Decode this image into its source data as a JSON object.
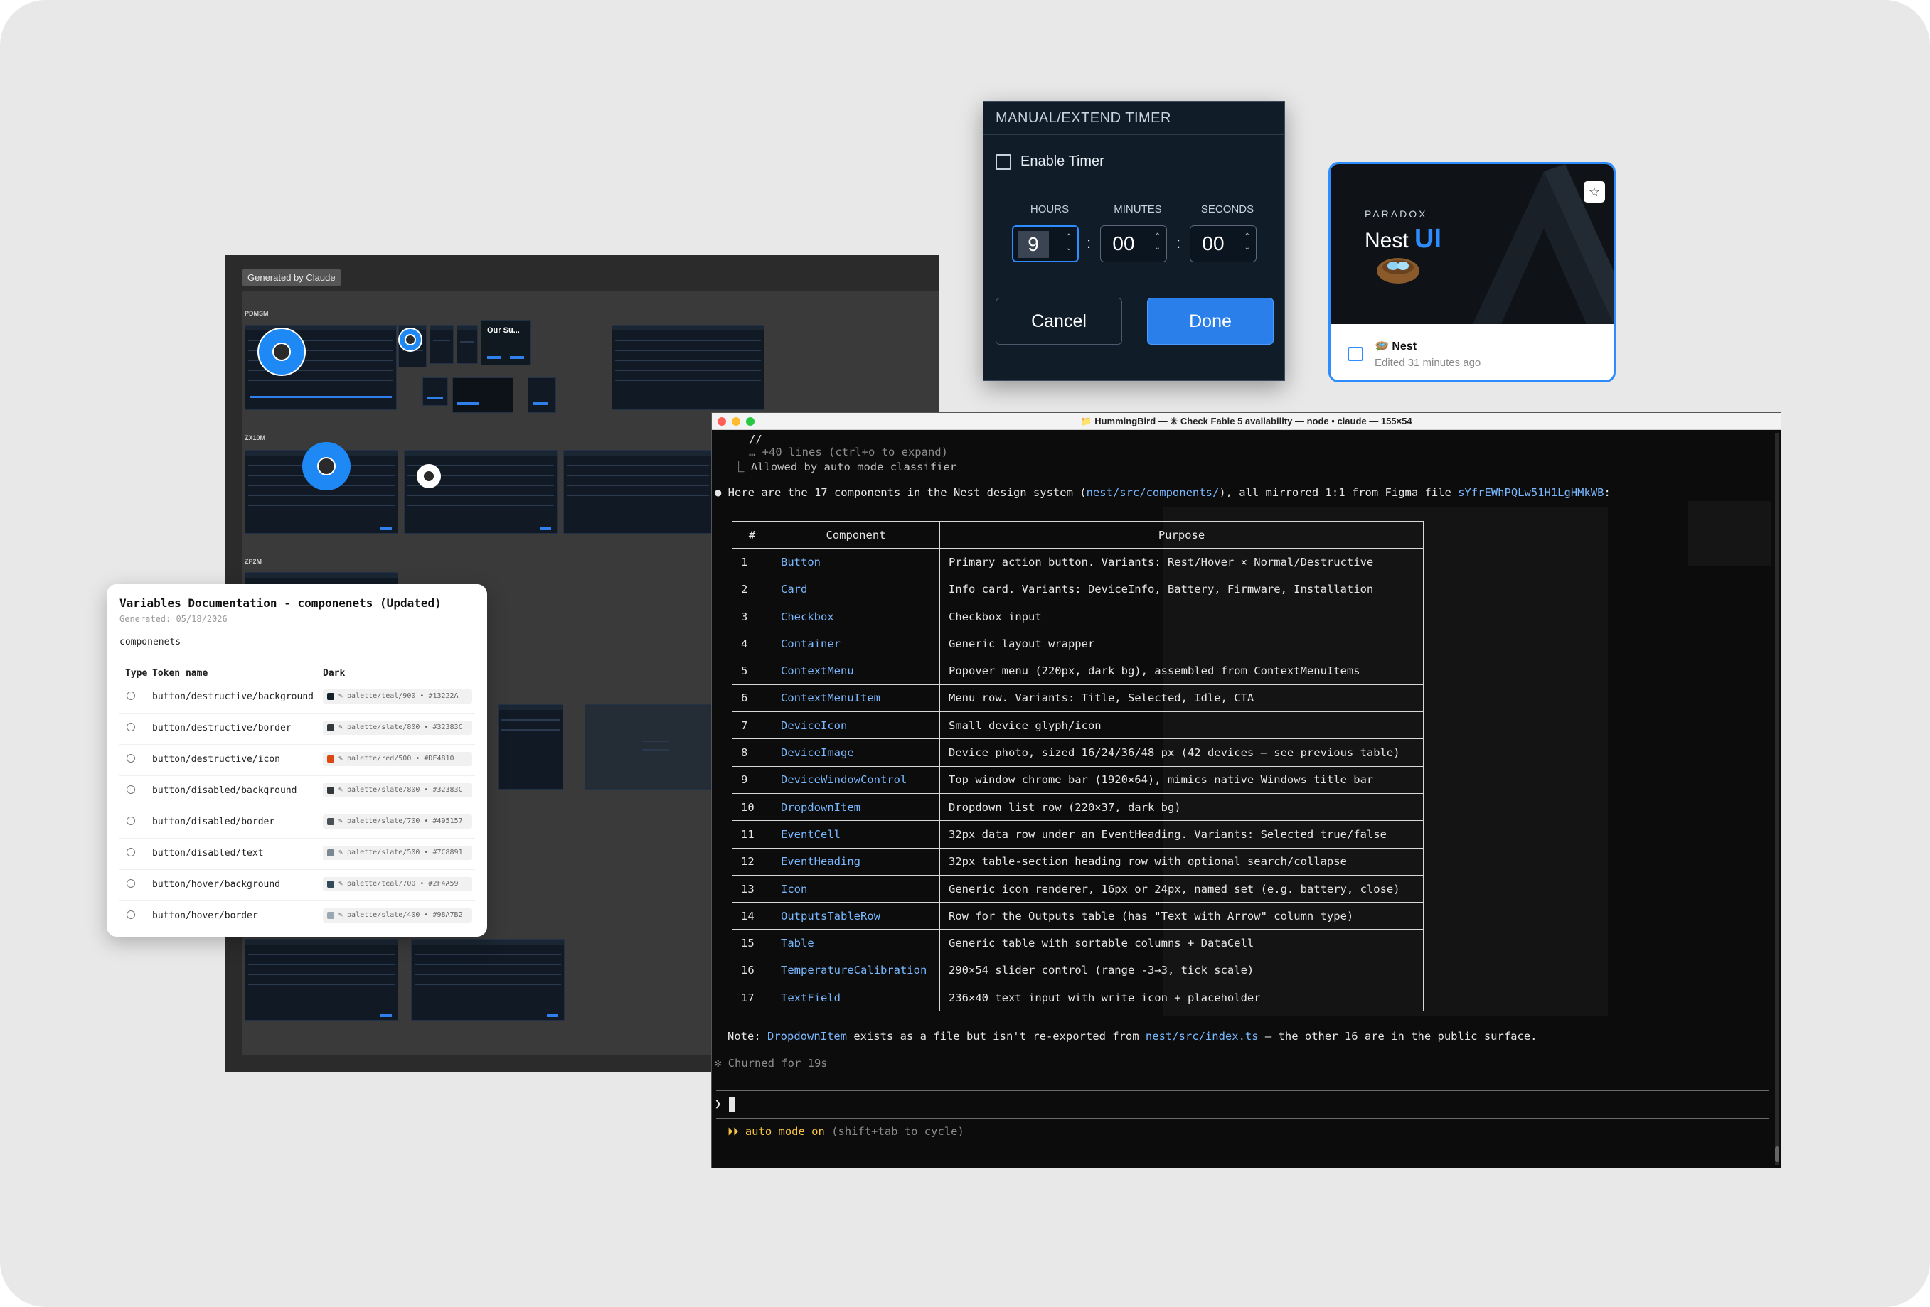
{
  "figma": {
    "badge": "Generated by Claude",
    "sections": [
      "PDMSM",
      "ZX10M",
      "ZP2M"
    ],
    "thumb_label": "Our Su..."
  },
  "vardoc": {
    "title": "Variables Documentation - componenets (Updated)",
    "generated": "Generated: 05/18/2026",
    "collection": "componenets",
    "columns": [
      "Type",
      "Token name",
      "Dark"
    ],
    "rows": [
      {
        "name": "button/destructive/background",
        "value": "✎ palette/teal/900  • #13222A",
        "swatch": "#13222A"
      },
      {
        "name": "button/destructive/border",
        "value": "✎ palette/slate/800  • #32383C",
        "swatch": "#32383C"
      },
      {
        "name": "button/destructive/icon",
        "value": "✎ palette/red/500  • #DE4810",
        "swatch": "#DE4810"
      },
      {
        "name": "button/disabled/background",
        "value": "✎ palette/slate/800  • #32383C",
        "swatch": "#32383C"
      },
      {
        "name": "button/disabled/border",
        "value": "✎ palette/slate/700  • #495157",
        "swatch": "#495157"
      },
      {
        "name": "button/disabled/text",
        "value": "✎ palette/slate/500  • #7C8891",
        "swatch": "#7C8891"
      },
      {
        "name": "button/hover/background",
        "value": "✎ palette/teal/700  • #2F4A59",
        "swatch": "#2F4A59"
      },
      {
        "name": "button/hover/border",
        "value": "✎ palette/slate/400  • #98A7B2",
        "swatch": "#98A7B2"
      }
    ]
  },
  "timer": {
    "title": "MANUAL/EXTEND TIMER",
    "enable_label": "Enable Timer",
    "units": [
      "HOURS",
      "MINUTES",
      "SECONDS"
    ],
    "values": [
      "9",
      "00",
      "00"
    ],
    "separator": ":",
    "cancel": "Cancel",
    "done": "Done"
  },
  "nest": {
    "brand": "PARADOX",
    "name_prefix": "Nest",
    "name_suffix": "UI",
    "title": "🪺 Nest",
    "edited": "Edited 31 minutes ago",
    "star_icon": "☆"
  },
  "terminal": {
    "title": "📁 HummingBird — ✳ Check Fable 5 availability — node • claude — 155×54",
    "lines": {
      "l1": "//",
      "l2": "… +40 lines (ctrl+o to expand)",
      "l3": "⎿ Allowed by auto mode classifier",
      "intro_a": "● Here are the 17 components in the Nest design system (",
      "intro_path": "nest/src/components/",
      "intro_b": "), all mirrored 1:1 from Figma file ",
      "intro_file": "sYfrEWhPQLw51H1LgHMkWB",
      "intro_c": ":",
      "note_a": "Note: ",
      "note_comp": "DropdownItem",
      "note_b": " exists as a file but isn't re-exported from ",
      "note_path": "nest/src/index.ts",
      "note_c": " — the other 16 are in the public surface.",
      "churn": "✻ Churned for 19s",
      "prompt": "❯",
      "mode_a": "⏵⏵ auto mode on",
      "mode_b": " (shift+tab to cycle)"
    },
    "table": {
      "headers": [
        "#",
        "Component",
        "Purpose"
      ],
      "rows": [
        [
          "1",
          "Button",
          "Primary action button. Variants: Rest/Hover × Normal/Destructive"
        ],
        [
          "2",
          "Card",
          "Info card. Variants: DeviceInfo, Battery, Firmware, Installation"
        ],
        [
          "3",
          "Checkbox",
          "Checkbox input"
        ],
        [
          "4",
          "Container",
          "Generic layout wrapper"
        ],
        [
          "5",
          "ContextMenu",
          "Popover menu (220px, dark bg), assembled from ContextMenuItems"
        ],
        [
          "6",
          "ContextMenuItem",
          "Menu row. Variants: Title, Selected, Idle, CTA"
        ],
        [
          "7",
          "DeviceIcon",
          "Small device glyph/icon"
        ],
        [
          "8",
          "DeviceImage",
          "Device photo, sized 16/24/36/48 px (42 devices — see previous table)"
        ],
        [
          "9",
          "DeviceWindowControl",
          "Top window chrome bar (1920×64), mimics native Windows title bar"
        ],
        [
          "10",
          "DropdownItem",
          "Dropdown list row (220×37, dark bg)"
        ],
        [
          "11",
          "EventCell",
          "32px data row under an EventHeading. Variants: Selected true/false"
        ],
        [
          "12",
          "EventHeading",
          "32px table-section heading row with optional search/collapse"
        ],
        [
          "13",
          "Icon",
          "Generic icon renderer, 16px or 24px, named set (e.g. battery, close)"
        ],
        [
          "14",
          "OutputsTableRow",
          "Row for the Outputs table (has \"Text with Arrow\" column type)"
        ],
        [
          "15",
          "Table",
          "Generic table with sortable columns + DataCell"
        ],
        [
          "16",
          "TemperatureCalibration",
          "290×54 slider control (range -3→3, tick scale)"
        ],
        [
          "17",
          "TextField",
          "236×40 text input with write icon + placeholder"
        ]
      ]
    }
  }
}
